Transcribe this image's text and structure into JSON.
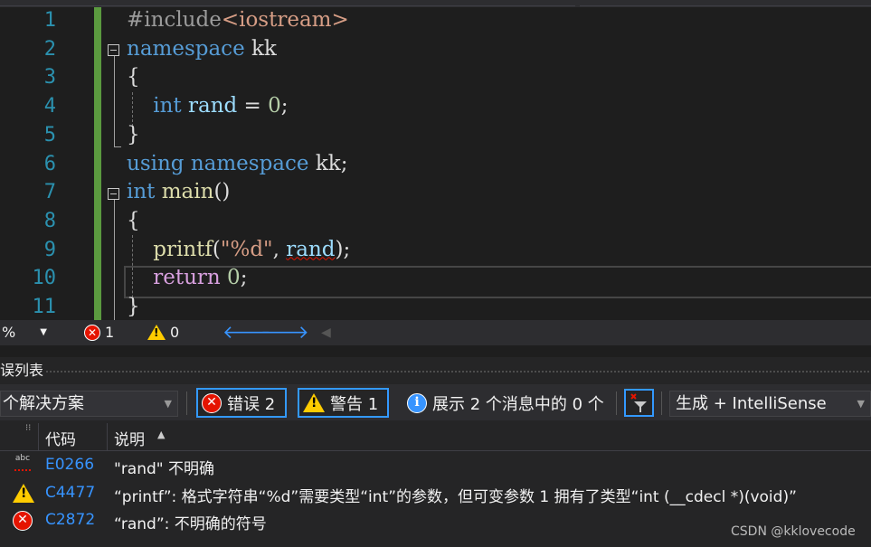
{
  "editor": {
    "line_numbers": [
      "1",
      "2",
      "3",
      "4",
      "5",
      "6",
      "7",
      "8",
      "9",
      "10",
      "11"
    ],
    "lines": [
      {
        "parts": [
          {
            "t": "#include",
            "c": "pp"
          },
          {
            "t": "<iostream>",
            "c": "str"
          }
        ]
      },
      {
        "parts": [
          {
            "t": "namespace",
            "c": "kw"
          },
          {
            "t": " kk",
            "c": ""
          }
        ]
      },
      {
        "parts": [
          {
            "t": "{",
            "c": ""
          }
        ]
      },
      {
        "parts": [
          {
            "t": "    ",
            "c": ""
          },
          {
            "t": "int",
            "c": "kw"
          },
          {
            "t": " ",
            "c": ""
          },
          {
            "t": "rand",
            "c": "var"
          },
          {
            "t": " = ",
            "c": ""
          },
          {
            "t": "0",
            "c": "num"
          },
          {
            "t": ";",
            "c": ""
          }
        ]
      },
      {
        "parts": [
          {
            "t": "}",
            "c": ""
          }
        ]
      },
      {
        "parts": [
          {
            "t": "using",
            "c": "kw"
          },
          {
            "t": " ",
            "c": ""
          },
          {
            "t": "namespace",
            "c": "kw"
          },
          {
            "t": " kk;",
            "c": ""
          }
        ]
      },
      {
        "parts": [
          {
            "t": "int",
            "c": "kw"
          },
          {
            "t": " ",
            "c": ""
          },
          {
            "t": "main",
            "c": "fn"
          },
          {
            "t": "()",
            "c": ""
          }
        ]
      },
      {
        "parts": [
          {
            "t": "{",
            "c": ""
          }
        ]
      },
      {
        "parts": [
          {
            "t": "    ",
            "c": ""
          },
          {
            "t": "printf",
            "c": "fn"
          },
          {
            "t": "(",
            "c": ""
          },
          {
            "t": "\"%d\"",
            "c": "str"
          },
          {
            "t": ", ",
            "c": ""
          },
          {
            "t": "rand",
            "c": "var squig"
          },
          {
            "t": ");",
            "c": ""
          }
        ]
      },
      {
        "parts": [
          {
            "t": "    ",
            "c": ""
          },
          {
            "t": "return",
            "c": "kw2"
          },
          {
            "t": " ",
            "c": ""
          },
          {
            "t": "0",
            "c": "num"
          },
          {
            "t": ";",
            "c": ""
          }
        ]
      },
      {
        "parts": [
          {
            "t": "}",
            "c": ""
          }
        ]
      }
    ]
  },
  "statusbar": {
    "zoom": "%",
    "error_count": "1",
    "warning_count": "0"
  },
  "error_list": {
    "title": "误列表",
    "scope": "个解决方案",
    "errors_label": "错误 2",
    "warnings_label": "警告 1",
    "messages_label": "展示 2 个消息中的 0 个",
    "build_filter": "生成 + IntelliSense",
    "col_code": "代码",
    "col_desc": "说明",
    "rows": [
      {
        "type": "spelling",
        "icon": "spell-check-icon",
        "code": "E0266",
        "desc": "\"rand\" 不明确"
      },
      {
        "type": "warning",
        "icon": "warning-icon",
        "code": "C4477",
        "desc": "“printf”: 格式字符串“%d”需要类型“int”的参数，但可变参数 1 拥有了类型“int (__cdecl *)(void)”"
      },
      {
        "type": "error",
        "icon": "error-icon",
        "code": "C2872",
        "desc": "“rand”: 不明确的符号"
      }
    ]
  },
  "watermark": "CSDN @kklovecode",
  "colors": {
    "background": "#1e1e1e",
    "keyword": "#569cd6",
    "control_keyword": "#d8a0df",
    "function": "#dcdcaa",
    "string": "#d69d85",
    "number": "#b5cea8",
    "line_number": "#2b91af",
    "error_red": "#e51400",
    "warning_yellow": "#ffcc00",
    "link_blue": "#3794ff",
    "focus_border": "#3399ff"
  }
}
